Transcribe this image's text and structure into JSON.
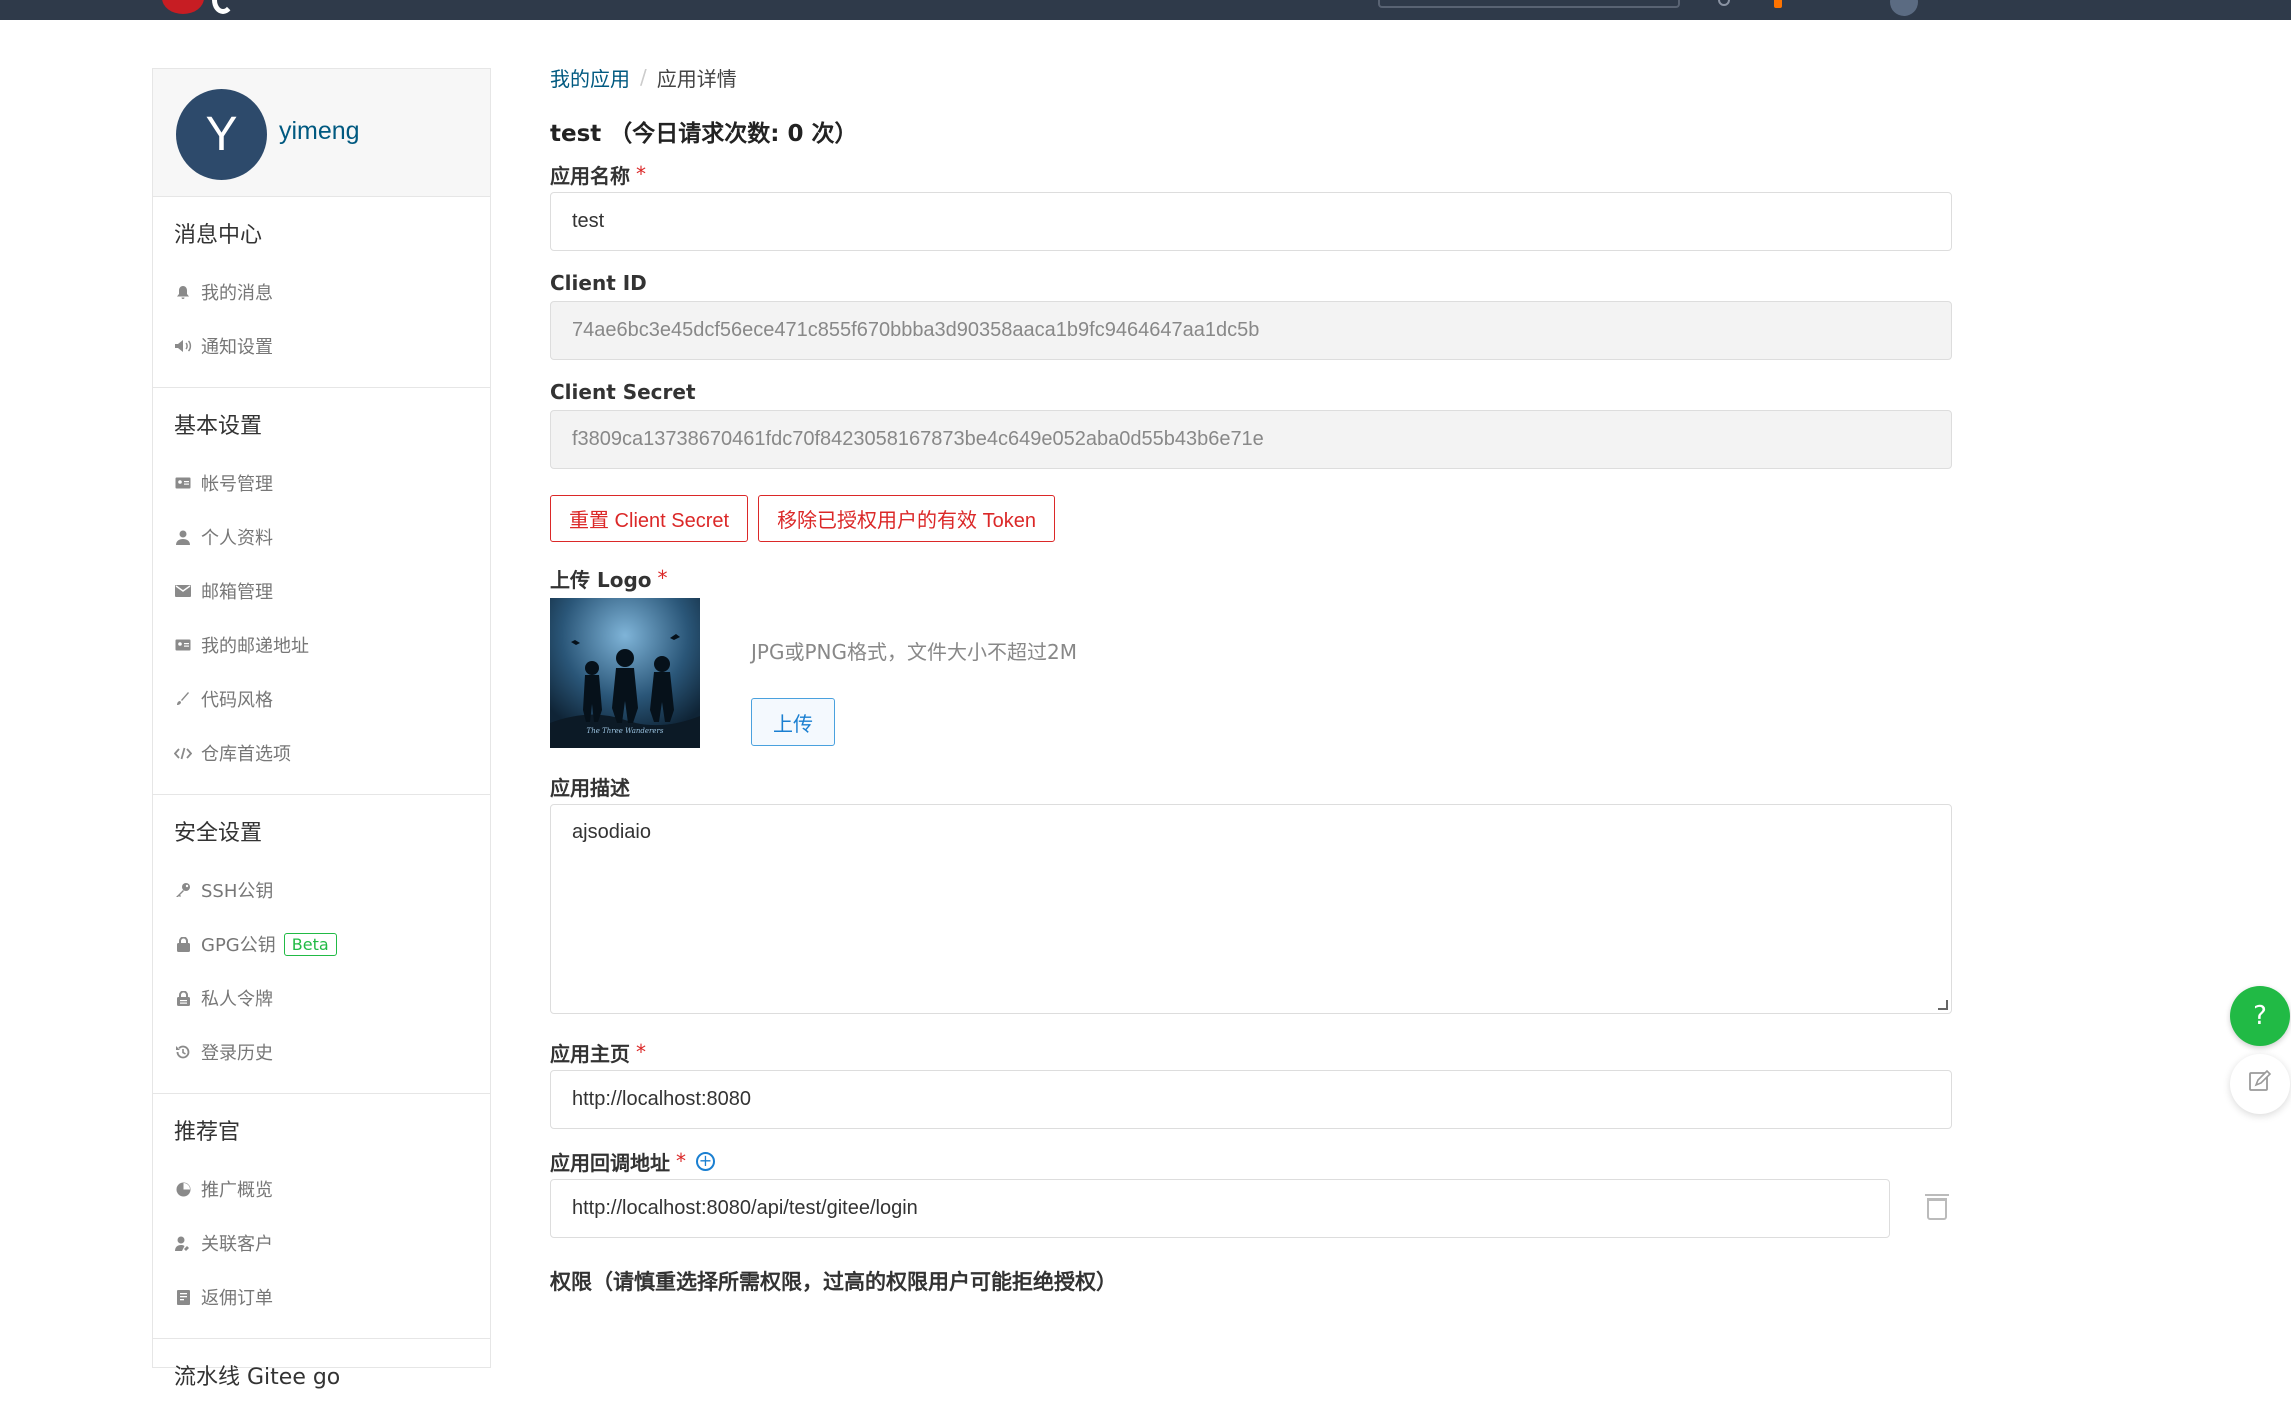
{
  "user": {
    "initial": "Y",
    "name": "yimeng"
  },
  "sidebar": {
    "sections": [
      {
        "title": "消息中心",
        "items": [
          {
            "icon": "bell-icon",
            "label": "我的消息"
          },
          {
            "icon": "volume-icon",
            "label": "通知设置"
          }
        ]
      },
      {
        "title": "基本设置",
        "items": [
          {
            "icon": "id-card-icon",
            "label": "帐号管理"
          },
          {
            "icon": "user-icon",
            "label": "个人资料"
          },
          {
            "icon": "mail-icon",
            "label": "邮箱管理"
          },
          {
            "icon": "address-card-icon",
            "label": "我的邮递地址"
          },
          {
            "icon": "paint-brush-icon",
            "label": "代码风格"
          },
          {
            "icon": "code-icon",
            "label": "仓库首选项"
          }
        ]
      },
      {
        "title": "安全设置",
        "items": [
          {
            "icon": "key-icon",
            "label": "SSH公钥"
          },
          {
            "icon": "lock-icon",
            "label": "GPG公钥",
            "badge": "Beta"
          },
          {
            "icon": "token-icon",
            "label": "私人令牌"
          },
          {
            "icon": "history-icon",
            "label": "登录历史"
          }
        ]
      },
      {
        "title": "推荐官",
        "items": [
          {
            "icon": "pie-chart-icon",
            "label": "推广概览"
          },
          {
            "icon": "user-link-icon",
            "label": "关联客户"
          },
          {
            "icon": "receipt-icon",
            "label": "返佣订单"
          }
        ]
      },
      {
        "title": "流水线 Gitee go",
        "items": []
      }
    ]
  },
  "breadcrumb": {
    "parent": "我的应用",
    "current": "应用详情"
  },
  "page_title": "test （今日请求次数: 0 次）",
  "form": {
    "app_name": {
      "label": "应用名称",
      "required": "*",
      "value": "test"
    },
    "client_id": {
      "label": "Client ID",
      "value": "74ae6bc3e45dcf56ece471c855f670bbba3d90358aaca1b9fc9464647aa1dc5b"
    },
    "client_secret": {
      "label": "Client Secret",
      "value": "f3809ca13738670461fdc70f8423058167873be4c649e052aba0d55b43b6e71e"
    },
    "reset_secret_button": "重置 Client Secret",
    "revoke_tokens_button": "移除已授权用户的有效 Token",
    "logo": {
      "label": "上传 Logo",
      "required": "*",
      "hint": "JPG或PNG格式，文件大小不超过2M",
      "upload_button": "上传"
    },
    "description": {
      "label": "应用描述",
      "value": "ajsodiaio"
    },
    "homepage": {
      "label": "应用主页",
      "required": "*",
      "value": "http://localhost:8080"
    },
    "callback": {
      "label": "应用回调地址",
      "required": "*",
      "value": "http://localhost:8080/api/test/gitee/login"
    },
    "permissions_label": "权限（请慎重选择所需权限，过高的权限用户可能拒绝授权）"
  },
  "float_buttons": {
    "help": "?"
  },
  "colors": {
    "accent": "#005980",
    "danger": "#db2828",
    "success": "#21ba45",
    "topbar": "#2f3a4a"
  }
}
